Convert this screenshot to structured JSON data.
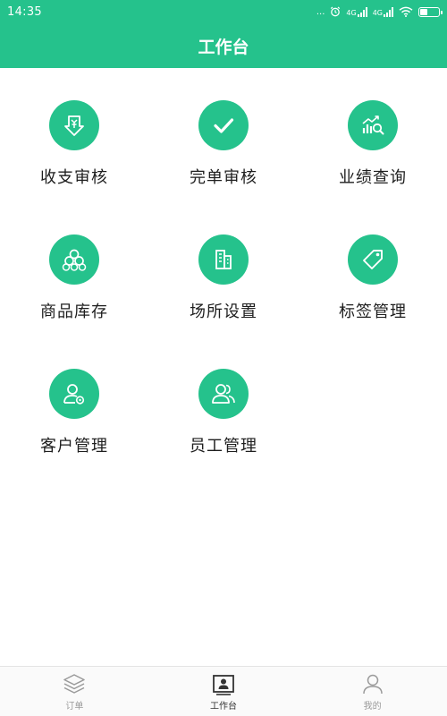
{
  "status": {
    "time": "14:35",
    "dots": "...",
    "signal_label_1": "4G",
    "signal_label_2": "4G"
  },
  "header": {
    "title": "工作台"
  },
  "menu": [
    {
      "label": "收支审核",
      "icon": "income-expense-icon"
    },
    {
      "label": "完单审核",
      "icon": "check-icon"
    },
    {
      "label": "业绩查询",
      "icon": "chart-search-icon"
    },
    {
      "label": "商品库存",
      "icon": "stock-icon"
    },
    {
      "label": "场所设置",
      "icon": "building-icon"
    },
    {
      "label": "标签管理",
      "icon": "tag-icon"
    },
    {
      "label": "客户管理",
      "icon": "customer-icon"
    },
    {
      "label": "员工管理",
      "icon": "staff-icon"
    }
  ],
  "tabs": [
    {
      "label": "订单",
      "icon": "layers-icon",
      "active": false
    },
    {
      "label": "工作台",
      "icon": "workbench-icon",
      "active": true
    },
    {
      "label": "我的",
      "icon": "user-icon",
      "active": false
    }
  ],
  "colors": {
    "accent": "#25c28c",
    "tab_inactive": "#9a9a9a",
    "tab_active": "#333333"
  }
}
